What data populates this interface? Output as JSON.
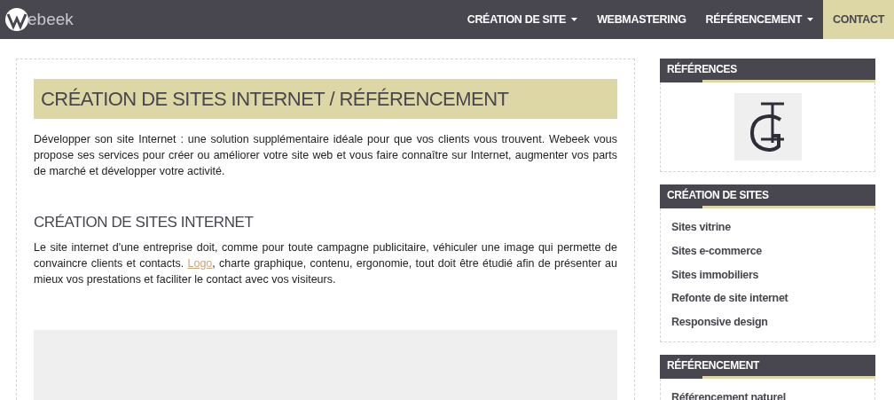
{
  "header": {
    "logo_text": "ebeek",
    "nav": [
      {
        "label": "CRÉATION DE SITE",
        "dropdown": true,
        "selected": false
      },
      {
        "label": "WEBMASTERING",
        "dropdown": false,
        "selected": false
      },
      {
        "label": "RÉFÉRENCEMENT",
        "dropdown": true,
        "selected": false
      },
      {
        "label": "CONTACT",
        "dropdown": false,
        "selected": true
      }
    ]
  },
  "main": {
    "title": "CRÉATION DE SITES INTERNET / RÉFÉRENCEMENT",
    "intro": "Développer son site Internet : une solution supplémentaire idéale pour que vos clients vous trouvent. Webeek vous propose ses services pour créer ou améliorer votre site web et vous faire connaître sur Internet, augmenter vos parts de marché et développer votre activité.",
    "section_title": "CRÉATION DE SITES INTERNET",
    "section_before": "Le site internet d'une entreprise doit, comme pour toute campagne publicitaire, véhiculer une image qui permette de convaincre clients et contacts. ",
    "section_link": "Logo",
    "section_after": ", charte graphique, contenu, ergonomie, tout doit être étudié afin de présenter au mieux vos prestations et faciliter le contact avec vos visiteurs."
  },
  "sidebar": [
    {
      "title": "RÉFÉRENCES",
      "kind": "logo"
    },
    {
      "title": "CRÉATION DE SITES",
      "kind": "links",
      "items": [
        "Sites vitrine",
        "Sites e-commerce",
        "Sites immobiliers",
        "Refonte de site internet",
        "Responsive design"
      ]
    },
    {
      "title": "RÉFÉRENCEMENT",
      "kind": "links",
      "items": [
        "Référencement naturel"
      ]
    }
  ]
}
